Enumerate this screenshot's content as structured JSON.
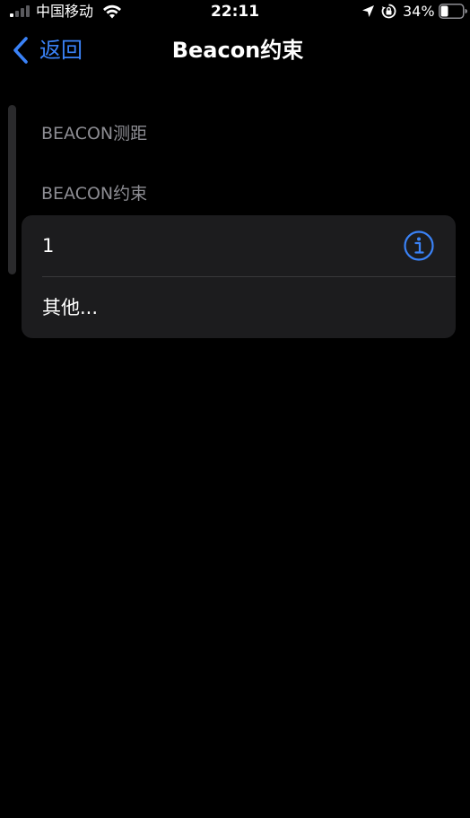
{
  "status_bar": {
    "carrier": "中国移动",
    "time": "22:11",
    "battery_percent": "34%",
    "battery_level": 0.34,
    "signal_bars_active": 1,
    "signal_bars_total": 4
  },
  "nav": {
    "back_label": "返回",
    "title": "Beacon约束"
  },
  "sections": [
    {
      "header": "BEACON测距"
    },
    {
      "header": "BEACON约束",
      "rows": [
        {
          "label": "1",
          "accessory": "info-icon"
        },
        {
          "label": "其他..."
        }
      ]
    }
  ],
  "colors": {
    "accent": "#3a82f7",
    "background": "#000000",
    "card": "#1c1c1e",
    "secondary_text": "#8d8d93"
  }
}
